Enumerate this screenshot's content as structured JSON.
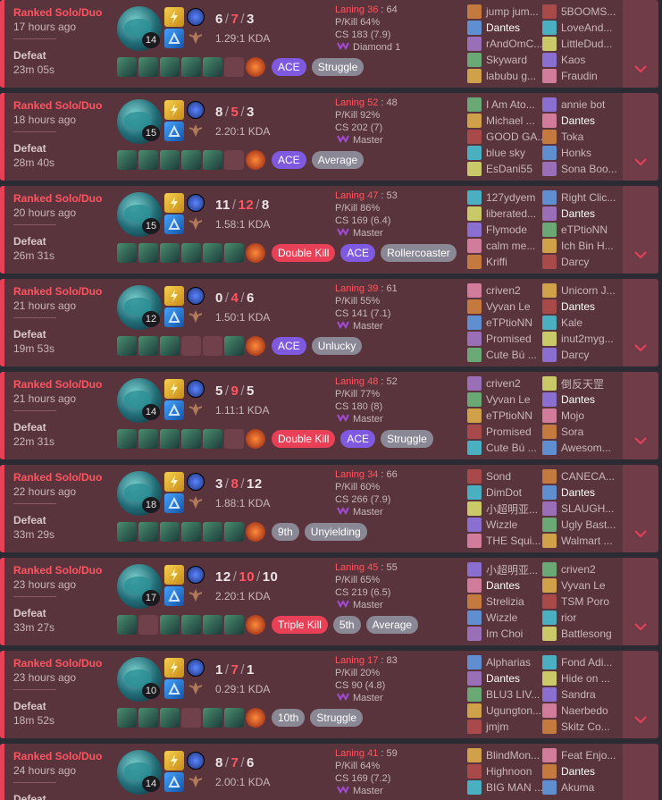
{
  "matches": [
    {
      "queue": "Ranked Solo/Duo",
      "ago": "17 hours ago",
      "result": "Defeat",
      "duration": "23m 05s",
      "level": "14",
      "kills": "6",
      "deaths": "7",
      "assists": "3",
      "kda": "1.29:1 KDA",
      "laning": "Laning 36",
      "laning_opp": "64",
      "pkill": "P/Kill 64%",
      "cs": "CS 183 (7.9)",
      "rank": "Diamond 1",
      "items_full": [
        1,
        1,
        1,
        1,
        1,
        0
      ],
      "badges": [
        {
          "text": "ACE",
          "kind": "ace"
        },
        {
          "text": "Struggle",
          "kind": "gray"
        }
      ],
      "team1": [
        {
          "name": "jump jum...",
          "me": false
        },
        {
          "name": "Dantes",
          "me": true
        },
        {
          "name": "rAndOmC...",
          "me": false
        },
        {
          "name": "Skyward",
          "me": false
        },
        {
          "name": "labubu g...",
          "me": false
        }
      ],
      "team2": [
        {
          "name": "5BOOMS...",
          "me": false
        },
        {
          "name": "LoveAnd...",
          "me": false
        },
        {
          "name": "LittleDud...",
          "me": false
        },
        {
          "name": "Kaos",
          "me": false
        },
        {
          "name": "Fraudin",
          "me": false
        }
      ]
    },
    {
      "queue": "Ranked Solo/Duo",
      "ago": "18 hours ago",
      "result": "Defeat",
      "duration": "28m 40s",
      "level": "15",
      "kills": "8",
      "deaths": "5",
      "assists": "3",
      "kda": "2.20:1 KDA",
      "laning": "Laning 52",
      "laning_opp": "48",
      "pkill": "P/Kill 92%",
      "cs": "CS 202 (7)",
      "rank": "Master",
      "items_full": [
        1,
        1,
        1,
        1,
        1,
        0
      ],
      "badges": [
        {
          "text": "ACE",
          "kind": "ace"
        },
        {
          "text": "Average",
          "kind": "gray"
        }
      ],
      "team1": [
        {
          "name": "I Am Ato...",
          "me": false
        },
        {
          "name": "Michael ...",
          "me": false
        },
        {
          "name": "GOOD GA...",
          "me": false
        },
        {
          "name": "blue sky",
          "me": false
        },
        {
          "name": "EsDani55",
          "me": false
        }
      ],
      "team2": [
        {
          "name": "annie bot",
          "me": false
        },
        {
          "name": "Dantes",
          "me": true
        },
        {
          "name": "Toka",
          "me": false
        },
        {
          "name": "Honks",
          "me": false
        },
        {
          "name": "Sona Boo...",
          "me": false
        }
      ]
    },
    {
      "queue": "Ranked Solo/Duo",
      "ago": "20 hours ago",
      "result": "Defeat",
      "duration": "26m 31s",
      "level": "15",
      "kills": "11",
      "deaths": "12",
      "assists": "8",
      "kda": "1.58:1 KDA",
      "laning": "Laning 47",
      "laning_opp": "53",
      "pkill": "P/Kill 86%",
      "cs": "CS 169 (6.4)",
      "rank": "Master",
      "items_full": [
        1,
        1,
        1,
        1,
        1,
        1
      ],
      "badges": [
        {
          "text": "Double Kill",
          "kind": "multi"
        },
        {
          "text": "ACE",
          "kind": "ace"
        },
        {
          "text": "Rollercoaster",
          "kind": "gray"
        }
      ],
      "team1": [
        {
          "name": "127ydyem",
          "me": false
        },
        {
          "name": "liberated...",
          "me": false
        },
        {
          "name": "Flymode",
          "me": false
        },
        {
          "name": "calm me...",
          "me": false
        },
        {
          "name": "Kriffi",
          "me": false
        }
      ],
      "team2": [
        {
          "name": "Right Clic...",
          "me": false
        },
        {
          "name": "Dantes",
          "me": true
        },
        {
          "name": "eTPtioNN",
          "me": false
        },
        {
          "name": "Ich Bin H...",
          "me": false
        },
        {
          "name": "Darcy",
          "me": false
        }
      ]
    },
    {
      "queue": "Ranked Solo/Duo",
      "ago": "21 hours ago",
      "result": "Defeat",
      "duration": "19m 53s",
      "level": "12",
      "kills": "0",
      "deaths": "4",
      "assists": "6",
      "kda": "1.50:1 KDA",
      "laning": "Laning 39",
      "laning_opp": "61",
      "pkill": "P/Kill 55%",
      "cs": "CS 141 (7.1)",
      "rank": "Master",
      "items_full": [
        1,
        1,
        1,
        0,
        0,
        1
      ],
      "badges": [
        {
          "text": "ACE",
          "kind": "ace"
        },
        {
          "text": "Unlucky",
          "kind": "gray"
        }
      ],
      "team1": [
        {
          "name": "criven2",
          "me": false
        },
        {
          "name": "Vyvan Le",
          "me": false
        },
        {
          "name": "eTPtioNN",
          "me": false
        },
        {
          "name": "Promised",
          "me": false
        },
        {
          "name": "Cute Bú ...",
          "me": false
        }
      ],
      "team2": [
        {
          "name": "Unicorn J...",
          "me": false
        },
        {
          "name": "Dantes",
          "me": true
        },
        {
          "name": "Kale",
          "me": false
        },
        {
          "name": "inut2myg...",
          "me": false
        },
        {
          "name": "Darcy",
          "me": false
        }
      ]
    },
    {
      "queue": "Ranked Solo/Duo",
      "ago": "21 hours ago",
      "result": "Defeat",
      "duration": "22m 31s",
      "level": "14",
      "kills": "5",
      "deaths": "9",
      "assists": "5",
      "kda": "1.11:1 KDA",
      "laning": "Laning 48",
      "laning_opp": "52",
      "pkill": "P/Kill 77%",
      "cs": "CS 180 (8)",
      "rank": "Master",
      "items_full": [
        1,
        1,
        1,
        1,
        1,
        0
      ],
      "badges": [
        {
          "text": "Double Kill",
          "kind": "multi"
        },
        {
          "text": "ACE",
          "kind": "ace"
        },
        {
          "text": "Struggle",
          "kind": "gray"
        }
      ],
      "team1": [
        {
          "name": "criven2",
          "me": false
        },
        {
          "name": "Vyvan Le",
          "me": false
        },
        {
          "name": "eTPtioNN",
          "me": false
        },
        {
          "name": "Promised",
          "me": false
        },
        {
          "name": "Cute Bú ...",
          "me": false
        }
      ],
      "team2": [
        {
          "name": "倒反天罡",
          "me": false
        },
        {
          "name": "Dantes",
          "me": true
        },
        {
          "name": "Mojo",
          "me": false
        },
        {
          "name": "Sora",
          "me": false
        },
        {
          "name": "Awesom...",
          "me": false
        }
      ]
    },
    {
      "queue": "Ranked Solo/Duo",
      "ago": "22 hours ago",
      "result": "Defeat",
      "duration": "33m 29s",
      "level": "18",
      "kills": "3",
      "deaths": "8",
      "assists": "12",
      "kda": "1.88:1 KDA",
      "laning": "Laning 34",
      "laning_opp": "66",
      "pkill": "P/Kill 60%",
      "cs": "CS 266 (7.9)",
      "rank": "Master",
      "items_full": [
        1,
        1,
        1,
        1,
        1,
        1
      ],
      "badges": [
        {
          "text": "9th",
          "kind": "gray"
        },
        {
          "text": "Unyielding",
          "kind": "gray"
        }
      ],
      "team1": [
        {
          "name": "Sond",
          "me": false
        },
        {
          "name": "DimDot",
          "me": false
        },
        {
          "name": "小超明亚...",
          "me": false
        },
        {
          "name": "Wizzle",
          "me": false
        },
        {
          "name": "THE Squi...",
          "me": false
        }
      ],
      "team2": [
        {
          "name": "CANECA...",
          "me": false
        },
        {
          "name": "Dantes",
          "me": true
        },
        {
          "name": "SLAUGH...",
          "me": false
        },
        {
          "name": "Ugly Bast...",
          "me": false
        },
        {
          "name": "Walmart ...",
          "me": false
        }
      ]
    },
    {
      "queue": "Ranked Solo/Duo",
      "ago": "23 hours ago",
      "result": "Defeat",
      "duration": "33m 27s",
      "level": "17",
      "kills": "12",
      "deaths": "10",
      "assists": "10",
      "kda": "2.20:1 KDA",
      "laning": "Laning 45",
      "laning_opp": "55",
      "pkill": "P/Kill 65%",
      "cs": "CS 219 (6.5)",
      "rank": "Master",
      "items_full": [
        1,
        0,
        1,
        1,
        1,
        1
      ],
      "badges": [
        {
          "text": "Triple Kill",
          "kind": "multi"
        },
        {
          "text": "5th",
          "kind": "gray"
        },
        {
          "text": "Average",
          "kind": "gray"
        }
      ],
      "team1": [
        {
          "name": "小超明亚...",
          "me": false
        },
        {
          "name": "Dantes",
          "me": true
        },
        {
          "name": "Strelizia",
          "me": false
        },
        {
          "name": "Wizzle",
          "me": false
        },
        {
          "name": "Im Choi",
          "me": false
        }
      ],
      "team2": [
        {
          "name": "criven2",
          "me": false
        },
        {
          "name": "Vyvan Le",
          "me": false
        },
        {
          "name": "TSM Poro",
          "me": false
        },
        {
          "name": "rior",
          "me": false
        },
        {
          "name": "Battlesong",
          "me": false
        }
      ]
    },
    {
      "queue": "Ranked Solo/Duo",
      "ago": "23 hours ago",
      "result": "Defeat",
      "duration": "18m 52s",
      "level": "10",
      "kills": "1",
      "deaths": "7",
      "assists": "1",
      "kda": "0.29:1 KDA",
      "laning": "Laning 17",
      "laning_opp": "83",
      "pkill": "P/Kill 20%",
      "cs": "CS 90 (4.8)",
      "rank": "Master",
      "items_full": [
        1,
        1,
        1,
        0,
        1,
        1
      ],
      "badges": [
        {
          "text": "10th",
          "kind": "gray"
        },
        {
          "text": "Struggle",
          "kind": "gray"
        }
      ],
      "team1": [
        {
          "name": "Alpharias",
          "me": false
        },
        {
          "name": "Dantes",
          "me": true
        },
        {
          "name": "BLU3 LIV...",
          "me": false
        },
        {
          "name": "Ugungton...",
          "me": false
        },
        {
          "name": "jmjm",
          "me": false
        }
      ],
      "team2": [
        {
          "name": "Fond Adi...",
          "me": false
        },
        {
          "name": "Hide on ...",
          "me": false
        },
        {
          "name": "Sandra",
          "me": false
        },
        {
          "name": "Naerbedo",
          "me": false
        },
        {
          "name": "Skitz Co...",
          "me": false
        }
      ]
    },
    {
      "queue": "Ranked Solo/Duo",
      "ago": "24 hours ago",
      "result": "Defeat",
      "duration": "",
      "level": "14",
      "kills": "8",
      "deaths": "7",
      "assists": "6",
      "kda": "2.00:1 KDA",
      "laning": "Laning 41",
      "laning_opp": "59",
      "pkill": "P/Kill 64%",
      "cs": "CS 169 (7.2)",
      "rank": "Master",
      "items_full": [
        1,
        1,
        1,
        1,
        1,
        1
      ],
      "badges": [],
      "team1": [
        {
          "name": "BlindMon...",
          "me": false
        },
        {
          "name": "Highnoon",
          "me": false
        },
        {
          "name": "BIG MAN ...",
          "me": false
        },
        {
          "name": "",
          "me": false
        },
        {
          "name": "",
          "me": false
        }
      ],
      "team2": [
        {
          "name": "Feat Enjo...",
          "me": false
        },
        {
          "name": "Dantes",
          "me": true
        },
        {
          "name": "Akuma",
          "me": false
        },
        {
          "name": "",
          "me": false
        },
        {
          "name": "",
          "me": false
        }
      ]
    }
  ],
  "colors": {
    "loss_accent": "#e84057",
    "card_bg": "#59343c",
    "ace": "#7f5ae0",
    "multikill": "#e84057",
    "badge_gray": "#8a8894"
  },
  "icons": {
    "expand": "chevron-down-icon",
    "summoner_spell_1": "flash-icon",
    "summoner_spell_2": "teleport-icon",
    "rank": "rank-crest-icon"
  }
}
